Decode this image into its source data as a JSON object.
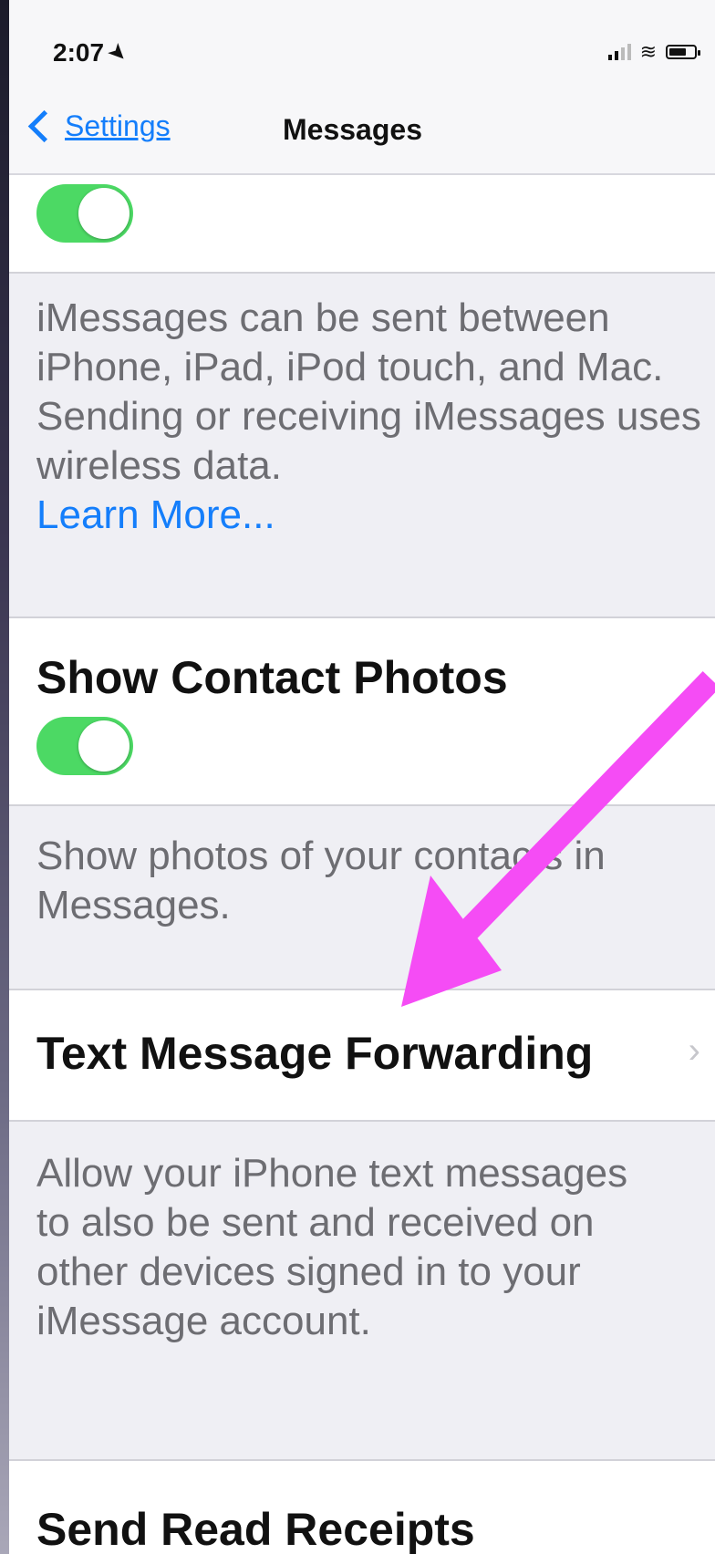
{
  "status_bar": {
    "time": "2:07",
    "location_icon": "location-arrow-icon",
    "signal_icon": "cellular-signal-icon",
    "wifi_icon": "wifi-icon",
    "battery_icon": "battery-icon"
  },
  "nav": {
    "back_label": "Settings",
    "title": "Messages"
  },
  "imessage": {
    "toggle_on": true,
    "footer": "iMessages can be sent between iPhone, iPad, iPod touch, and Mac. Sending or receiving iMessages uses wireless data.",
    "learn_more": "Learn More..."
  },
  "show_contact_photos": {
    "label": "Show Contact Photos",
    "toggle_on": true,
    "footer": "Show photos of your contacts in Messages."
  },
  "text_forwarding": {
    "label": "Text Message Forwarding",
    "disclosure": "›",
    "footer": "Allow your iPhone text messages to also be sent and received on other devices signed in to your iMessage account."
  },
  "send_read_receipts": {
    "label": "Send Read Receipts"
  },
  "colors": {
    "accent": "#147efb",
    "toggle_on": "#4cd964",
    "annotation_arrow": "#f54cf5",
    "group_background": "#efeff4"
  }
}
